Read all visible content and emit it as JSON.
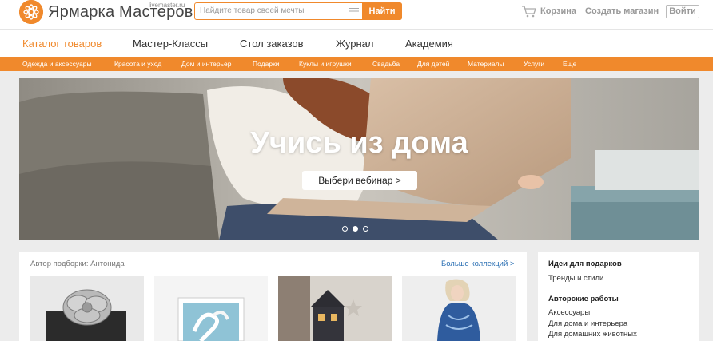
{
  "header": {
    "logo_text": "Ярмарка Мастеров",
    "logo_domain": "livemaster.ru",
    "search_placeholder": "Найдите товар своей мечты",
    "search_button": "Найти",
    "cart_label": "Корзина",
    "create_shop_label": "Создать магазин",
    "login_label": "Войти"
  },
  "main_nav": [
    {
      "label": "Каталог товаров",
      "active": true
    },
    {
      "label": "Мастер-Классы",
      "active": false
    },
    {
      "label": "Стол заказов",
      "active": false
    },
    {
      "label": "Журнал",
      "active": false
    },
    {
      "label": "Академия",
      "active": false
    }
  ],
  "categories": [
    "Одежда и аксессуары",
    "Красота и уход",
    "Дом и интерьер",
    "Подарки",
    "Куклы и игрушки",
    "Свадьба",
    "Для детей",
    "Материалы",
    "Услуги",
    "Еще"
  ],
  "banner": {
    "title": "Учись из дома",
    "button_label": "Выбери вебинар >",
    "slide_count": 3,
    "active_slide": 2
  },
  "collection": {
    "author": "Автор подборки: Антонида",
    "more_link": "Больше коллекций >",
    "thumbnails": [
      "silver-flower-brooch",
      "flamingo-painting",
      "miniature-house",
      "woman-in-blue-dress"
    ]
  },
  "side_panel": {
    "gift_ideas_heading": "Идеи для подарков",
    "gift_ideas_link": "Тренды и стили",
    "works_heading": "Авторские работы",
    "works_links": [
      "Аксессуары",
      "Для дома и интерьера",
      "Для домашних животных"
    ]
  },
  "colors": {
    "accent": "#f0892c",
    "link": "#2a6fb3",
    "page_bg": "#ececec"
  }
}
